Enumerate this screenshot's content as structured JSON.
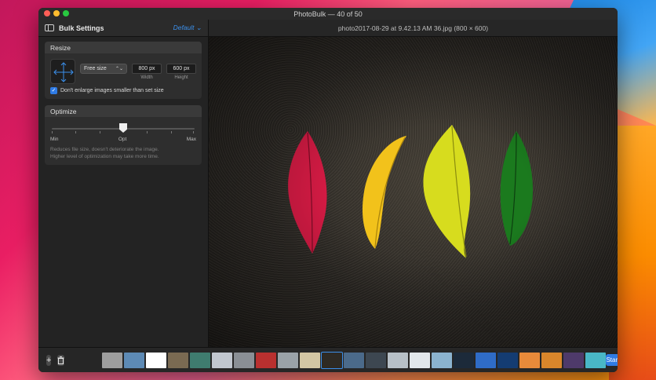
{
  "window": {
    "title": "PhotoBulk — 40 of 50"
  },
  "toolbar": {
    "sidebar_title": "Bulk Settings",
    "preset": "Default ⌄",
    "filename": "photo2017-08-29 at 9.42.13 AM 36.jpg (800 × 600)"
  },
  "resize": {
    "header": "Resize",
    "mode": "Free size",
    "mode_arrow": "⌃⌄",
    "width_value": "800 px",
    "width_label": "Width",
    "height_value": "600 px",
    "height_label": "Height",
    "dont_enlarge_checked": true,
    "dont_enlarge_label": "Don't enlarge images smaller than set size"
  },
  "optimize": {
    "header": "Optimize",
    "min_label": "Min",
    "opt_label": "Opt",
    "max_label": "Max",
    "level": 0.5,
    "description_line1": "Reduces file size, doesn't deteriorate the image.",
    "description_line2": "Higher level of optimization may take more time."
  },
  "bottom_bar": {
    "add_label": "+",
    "delete_icon": "trash-icon",
    "start_label": "Start"
  },
  "colors": {
    "accent": "#2f7be4",
    "leaf_red": "#d81b45",
    "leaf_yellow": "#f2c21b",
    "leaf_lime": "#d7dc1e",
    "leaf_green": "#1b7a1e"
  },
  "thumbnails": [
    {
      "color": "#9e9e9e"
    },
    {
      "color": "#5d8ab5"
    },
    {
      "color": "#ffffff"
    },
    {
      "color": "#7a6a52"
    },
    {
      "color": "#3f7c6f"
    },
    {
      "color": "#c1c7cf"
    },
    {
      "color": "#8a8f95"
    },
    {
      "color": "#b9302f"
    },
    {
      "color": "#9aa2a8"
    },
    {
      "color": "#d3c6a4"
    },
    {
      "color": "#2e2a24",
      "selected": true
    },
    {
      "color": "#4b6a8a"
    },
    {
      "color": "#3d4751"
    },
    {
      "color": "#b7c0c7"
    },
    {
      "color": "#e2e7eb"
    },
    {
      "color": "#8bb3cf"
    },
    {
      "color": "#1c2a3a"
    },
    {
      "color": "#2f6cc7"
    },
    {
      "color": "#143c72"
    },
    {
      "color": "#e88a3a"
    },
    {
      "color": "#d9862b"
    },
    {
      "color": "#4e3a6a"
    },
    {
      "color": "#49b7c6"
    }
  ]
}
